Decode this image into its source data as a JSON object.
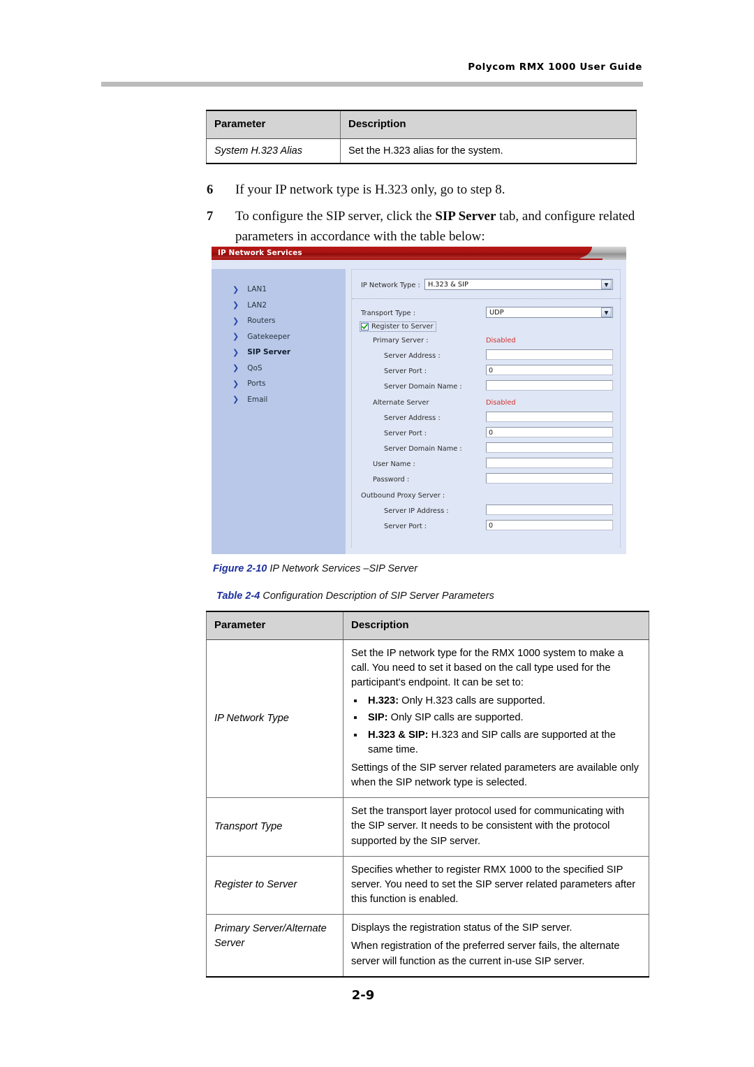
{
  "header": {
    "running_title": "Polycom RMX 1000 User Guide"
  },
  "top_table": {
    "columns": [
      "Parameter",
      "Description"
    ],
    "rows": [
      {
        "parameter": "System H.323 Alias",
        "description": "Set the H.323 alias for the system."
      }
    ]
  },
  "steps": [
    {
      "number": "6",
      "text_before": "If your IP network type is H.323 only, go to step 8.",
      "bold": "",
      "text_after": ""
    },
    {
      "number": "7",
      "text_before": "To configure the SIP server, click the ",
      "bold": "SIP Server",
      "text_after": " tab, and configure related parameters in accordance with the table below:"
    }
  ],
  "app_screenshot": {
    "tab_title": "IP Network Services",
    "sidebar": {
      "items": [
        {
          "label": "LAN1",
          "active": false
        },
        {
          "label": "LAN2",
          "active": false
        },
        {
          "label": "Routers",
          "active": false
        },
        {
          "label": "Gatekeeper",
          "active": false
        },
        {
          "label": "SIP Server",
          "active": true
        },
        {
          "label": "QoS",
          "active": false
        },
        {
          "label": "Ports",
          "active": false
        },
        {
          "label": "Email",
          "active": false
        }
      ]
    },
    "form": {
      "ip_network_type_label": "IP Network Type :",
      "ip_network_type_value": "H.323 & SIP",
      "transport_type_label": "Transport Type :",
      "transport_type_value": "UDP",
      "register_to_server_label": "Register to Server",
      "register_to_server_checked": "true",
      "primary_server_label": "Primary Server :",
      "primary_server_status": "Disabled",
      "primary_server_address_label": "Server Address :",
      "primary_server_address_value": "",
      "primary_server_port_label": "Server Port :",
      "primary_server_port_value": "0",
      "primary_server_domain_label": "Server Domain Name :",
      "primary_server_domain_value": "",
      "alternate_server_label": "Alternate Server",
      "alternate_server_status": "Disabled",
      "alternate_server_address_label": "Server Address :",
      "alternate_server_address_value": "",
      "alternate_server_port_label": "Server Port :",
      "alternate_server_port_value": "0",
      "alternate_server_domain_label": "Server Domain Name :",
      "alternate_server_domain_value": "",
      "user_name_label": "User Name :",
      "user_name_value": "",
      "password_label": "Password :",
      "password_value": "",
      "outbound_proxy_label": "Outbound Proxy Server :",
      "outbound_proxy_ip_label": "Server IP Address :",
      "outbound_proxy_ip_value": "",
      "outbound_proxy_port_label": "Server Port :",
      "outbound_proxy_port_value": "0"
    },
    "colors": {
      "tab_red": "#a81210",
      "panel_blue": "#dfe6f5",
      "sidebar_blue": "#b9c8e8",
      "status_red": "#d0312d",
      "chevron_blue": "#2a46a8"
    }
  },
  "figure_caption": {
    "label": "Figure 2-10",
    "text": " IP Network Services –SIP Server"
  },
  "table_caption": {
    "label": "Table 2-4",
    "text": " Configuration Description of SIP Server Parameters"
  },
  "main_table": {
    "columns": [
      "Parameter",
      "Description"
    ],
    "rows": [
      {
        "parameter": "IP Network Type",
        "intro": "Set the IP network type for the RMX 1000 system to make a call. You need to set it based on the call type used for the participant's endpoint. It can be set to:",
        "bullets": [
          {
            "term": "H.323:",
            "text": " Only H.323 calls are supported."
          },
          {
            "term": "SIP:",
            "text": " Only SIP calls are supported."
          },
          {
            "term": "H.323 & SIP:",
            "text": " H.323 and SIP calls are supported at the same time."
          }
        ],
        "outro": "Settings of the SIP server related parameters are available only when the SIP network type is selected."
      },
      {
        "parameter": "Transport Type",
        "description": "Set the transport layer protocol used for communicating with the SIP server. It needs to be consistent with the protocol supported by the SIP server."
      },
      {
        "parameter": "Register to Server",
        "description": "Specifies whether to register RMX 1000 to the specified SIP server. You need to set the SIP server related parameters after this function is enabled."
      },
      {
        "parameter": "Primary Server/Alternate Server",
        "description_p1": "Displays the registration status of the SIP server.",
        "description_p2": "When registration of the preferred server fails, the alternate server will function as the current in-use SIP server."
      }
    ]
  },
  "footer": {
    "page_number": "2-9"
  }
}
